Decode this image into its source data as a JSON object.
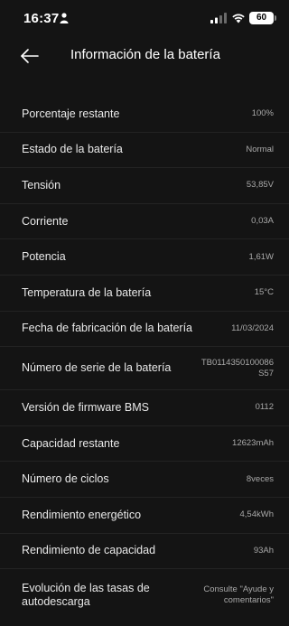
{
  "status_bar": {
    "time": "16:37",
    "battery_level": "60",
    "icons": [
      "person-icon",
      "cellular-signal-icon",
      "wifi-icon",
      "battery-icon"
    ]
  },
  "header": {
    "back_icon": "arrow-left-icon",
    "title": "Información de la batería"
  },
  "rows": [
    {
      "label": "Porcentaje restante",
      "value": "100%"
    },
    {
      "label": "Estado de la batería",
      "value": "Normal"
    },
    {
      "label": "Tensión",
      "value": "53,85V"
    },
    {
      "label": "Corriente",
      "value": "0,03A"
    },
    {
      "label": "Potencia",
      "value": "1,61W"
    },
    {
      "label": "Temperatura de la batería",
      "value": "15°C"
    },
    {
      "label": "Fecha de fabricación de la batería",
      "value": "11/03/2024"
    },
    {
      "label": "Número de serie de la batería",
      "value": "TB0114350100086\nS57"
    },
    {
      "label": "Versión de firmware BMS",
      "value": "0112"
    },
    {
      "label": "Capacidad restante",
      "value": "12623mAh"
    },
    {
      "label": "Número de ciclos",
      "value": "8veces"
    },
    {
      "label": "Rendimiento energético",
      "value": "4,54kWh"
    },
    {
      "label": "Rendimiento de capacidad",
      "value": "93Ah"
    },
    {
      "label": "Evolución de las tasas de autodescarga",
      "value": "Consulte \"Ayude y comentarios\""
    }
  ],
  "colors": {
    "background": "#141414",
    "divider": "#232323",
    "label": "#e9e9e9",
    "value": "#a9a9a9"
  }
}
